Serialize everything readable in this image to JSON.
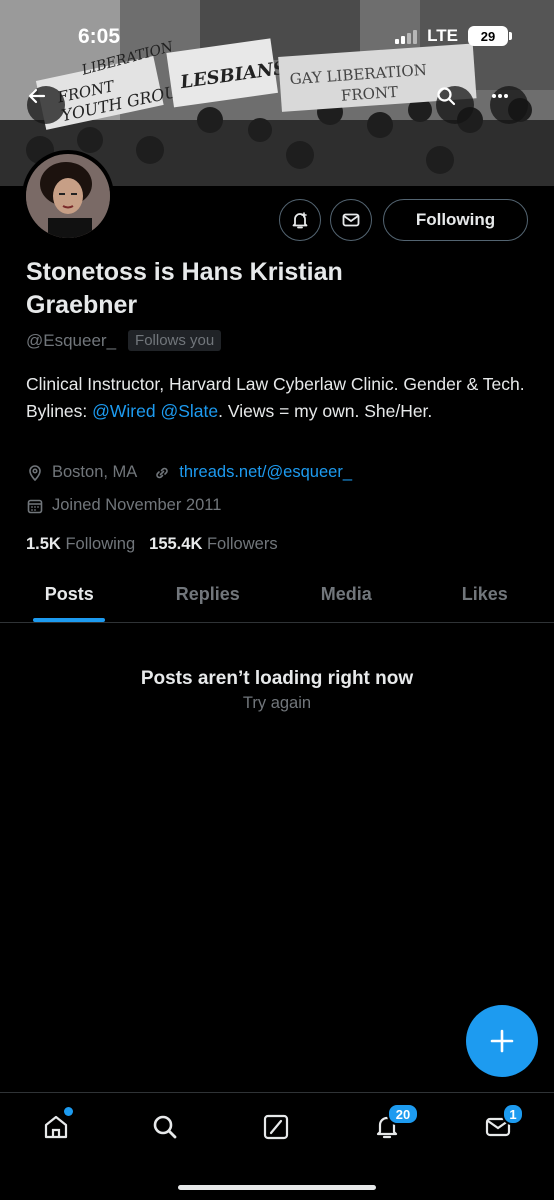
{
  "status_bar": {
    "time": "6:05",
    "network": "LTE",
    "battery": "29"
  },
  "banner": {
    "signs": [
      "FRONT",
      "YOUTH GROU",
      "LIBERATION",
      "LESBIANS",
      "GAY LIBERATION",
      "FRONT"
    ]
  },
  "profile": {
    "display_name": "Stonetoss is Hans Kristian Graebner",
    "handle": "@Esqueer_",
    "follows_you": "Follows you",
    "bio_text_1": "Clinical Instructor, Harvard Law Cyberlaw Clinic. Gender & Tech. Bylines: ",
    "bio_link_1": "@Wired",
    "bio_link_2": "@Slate",
    "bio_text_2": ". Views = my own. She/Her.",
    "location": "Boston, MA",
    "website": "threads.net/@esqueer_",
    "joined": "Joined November 2011",
    "following_count": "1.5K",
    "following_label": "Following",
    "followers_count": "155.4K",
    "followers_label": "Followers"
  },
  "actions": {
    "following_button": "Following"
  },
  "tabs": [
    {
      "label": "Posts",
      "active": true
    },
    {
      "label": "Replies",
      "active": false
    },
    {
      "label": "Media",
      "active": false
    },
    {
      "label": "Likes",
      "active": false
    }
  ],
  "empty_state": {
    "title": "Posts aren’t loading right now",
    "retry": "Try again"
  },
  "bottom_nav": {
    "notifications_badge": "20",
    "messages_badge": "1"
  },
  "colors": {
    "accent": "#1d9bf0",
    "background": "#000000",
    "muted": "#71767b",
    "text": "#e7e9ea"
  },
  "icons": [
    "back-arrow-icon",
    "search-icon",
    "more-icon",
    "bell-plus-icon",
    "mail-icon",
    "location-pin-icon",
    "link-icon",
    "calendar-icon",
    "plus-icon",
    "home-icon",
    "compose-square-icon",
    "bell-icon"
  ]
}
